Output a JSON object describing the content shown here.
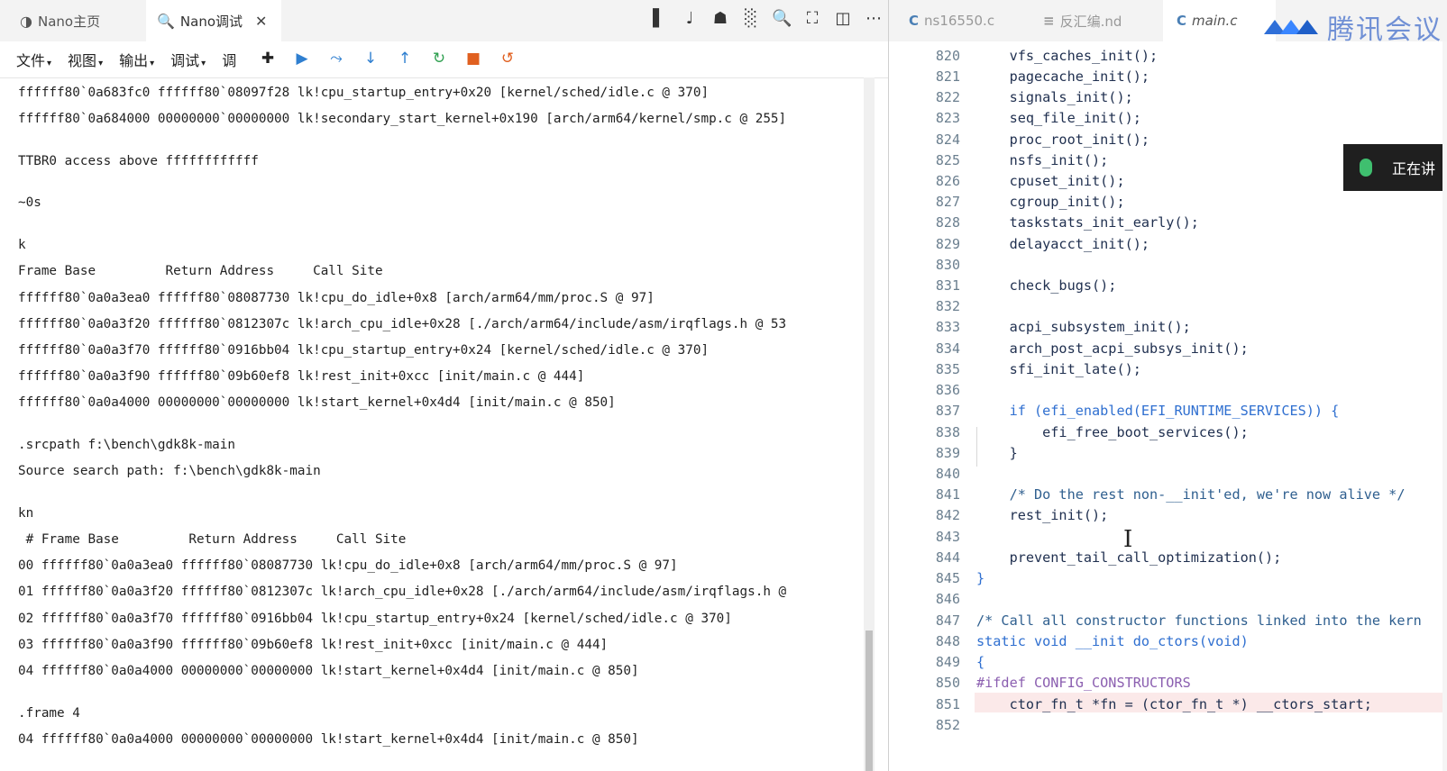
{
  "left_tabs": [
    {
      "icon": "◑",
      "label": "Nano主页"
    },
    {
      "icon": "🔍",
      "label": "Nano调试",
      "close": "✕"
    }
  ],
  "toolbar_icons": [
    "▌",
    "♩",
    "☗",
    "░",
    "🔍",
    "⛶",
    "◫",
    "⋯"
  ],
  "menu": [
    {
      "label": "文件",
      "caret": "▾"
    },
    {
      "label": "视图",
      "caret": "▾"
    },
    {
      "label": "输出",
      "caret": "▾"
    },
    {
      "label": "调试",
      "caret": "▾"
    },
    {
      "label": "调",
      "caret": ""
    }
  ],
  "debug_tools": {
    "move": "✚",
    "run": "▶",
    "step_over": "⤳",
    "step_into": "↓",
    "step_out": "↑",
    "restart": "↻",
    "stop": "■",
    "detach": "↺"
  },
  "console_lines": [
    "ffffff80`0a683fc0 ffffff80`08097f28 lk!cpu_startup_entry+0x20 [kernel/sched/idle.c @ 370]",
    "ffffff80`0a684000 00000000`00000000 lk!secondary_start_kernel+0x190 [arch/arm64/kernel/smp.c @ 255]",
    "",
    "TTBR0 access above ffffffffffff",
    "",
    "~0s",
    "",
    "k",
    "Frame Base         Return Address     Call Site",
    "ffffff80`0a0a3ea0 ffffff80`08087730 lk!cpu_do_idle+0x8 [arch/arm64/mm/proc.S @ 97]",
    "ffffff80`0a0a3f20 ffffff80`0812307c lk!arch_cpu_idle+0x28 [./arch/arm64/include/asm/irqflags.h @ 53",
    "ffffff80`0a0a3f70 ffffff80`0916bb04 lk!cpu_startup_entry+0x24 [kernel/sched/idle.c @ 370]",
    "ffffff80`0a0a3f90 ffffff80`09b60ef8 lk!rest_init+0xcc [init/main.c @ 444]",
    "ffffff80`0a0a4000 00000000`00000000 lk!start_kernel+0x4d4 [init/main.c @ 850]",
    "",
    ".srcpath f:\\bench\\gdk8k-main",
    "Source search path: f:\\bench\\gdk8k-main",
    "",
    "kn",
    " # Frame Base         Return Address     Call Site",
    "00 ffffff80`0a0a3ea0 ffffff80`08087730 lk!cpu_do_idle+0x8 [arch/arm64/mm/proc.S @ 97]",
    "01 ffffff80`0a0a3f20 ffffff80`0812307c lk!arch_cpu_idle+0x28 [./arch/arm64/include/asm/irqflags.h @",
    "02 ffffff80`0a0a3f70 ffffff80`0916bb04 lk!cpu_startup_entry+0x24 [kernel/sched/idle.c @ 370]",
    "03 ffffff80`0a0a3f90 ffffff80`09b60ef8 lk!rest_init+0xcc [init/main.c @ 444]",
    "04 ffffff80`0a0a4000 00000000`00000000 lk!start_kernel+0x4d4 [init/main.c @ 850]",
    "",
    ".frame 4",
    "04 ffffff80`0a0a4000 00000000`00000000 lk!start_kernel+0x4d4 [init/main.c @ 850]"
  ],
  "right_tabs": [
    {
      "icon": "C",
      "label": "ns16550.c"
    },
    {
      "icon": "≡",
      "label": "反汇编.nd"
    },
    {
      "icon": "C",
      "label": "main.c"
    }
  ],
  "logo_text": "腾讯会议",
  "recording_label": "正在讲",
  "code_lines": [
    {
      "n": "820",
      "t": "    vfs_caches_init();"
    },
    {
      "n": "821",
      "t": "    pagecache_init();"
    },
    {
      "n": "822",
      "t": "    signals_init();"
    },
    {
      "n": "823",
      "t": "    seq_file_init();"
    },
    {
      "n": "824",
      "t": "    proc_root_init();"
    },
    {
      "n": "825",
      "t": "    nsfs_init();"
    },
    {
      "n": "826",
      "t": "    cpuset_init();"
    },
    {
      "n": "827",
      "t": "    cgroup_init();"
    },
    {
      "n": "828",
      "t": "    taskstats_init_early();"
    },
    {
      "n": "829",
      "t": "    delayacct_init();"
    },
    {
      "n": "830",
      "t": ""
    },
    {
      "n": "831",
      "t": "    check_bugs();"
    },
    {
      "n": "832",
      "t": ""
    },
    {
      "n": "833",
      "t": "    acpi_subsystem_init();"
    },
    {
      "n": "834",
      "t": "    arch_post_acpi_subsys_init();"
    },
    {
      "n": "835",
      "t": "    sfi_init_late();"
    },
    {
      "n": "836",
      "t": ""
    },
    {
      "n": "837",
      "t": "    if (efi_enabled(EFI_RUNTIME_SERVICES)) {"
    },
    {
      "n": "838",
      "t": "        efi_free_boot_services();"
    },
    {
      "n": "839",
      "t": "    }"
    },
    {
      "n": "840",
      "t": ""
    },
    {
      "n": "841",
      "t": "    /* Do the rest non-__init'ed, we're now alive */"
    },
    {
      "n": "842",
      "t": "    rest_init();"
    },
    {
      "n": "843",
      "t": ""
    },
    {
      "n": "844",
      "t": "    prevent_tail_call_optimization();"
    },
    {
      "n": "845",
      "t": "}"
    },
    {
      "n": "846",
      "t": ""
    },
    {
      "n": "847",
      "t": "/* Call all constructor functions linked into the kern"
    },
    {
      "n": "848",
      "t": "static void __init do_ctors(void)"
    },
    {
      "n": "849",
      "t": "{"
    },
    {
      "n": "850",
      "t": "#ifdef CONFIG_CONSTRUCTORS"
    },
    {
      "n": "851",
      "t": "    ctor_fn_t *fn = (ctor_fn_t *) __ctors_start;"
    },
    {
      "n": "852",
      "t": ""
    }
  ],
  "text_cursor": "I",
  "colors": {
    "keyword": "#2f6fd0",
    "comment": "#2f5f8f",
    "preprocessor": "#8b5fb0",
    "line_number": "#6b7f8f",
    "highlight_line": "#fbe9e9"
  }
}
